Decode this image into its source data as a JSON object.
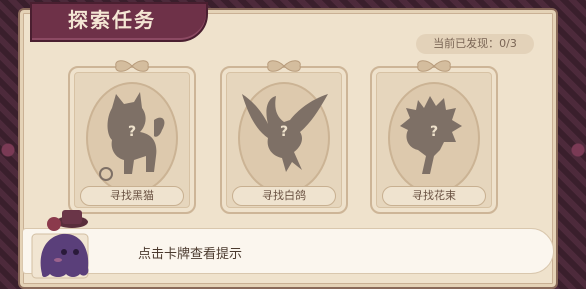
{
  "panel": {
    "title": "探索任务",
    "progress": "当前已发现：0/3"
  },
  "cards": [
    {
      "label": "寻找黑猫",
      "placeholder": "?",
      "icon": "cat-silhouette-icon"
    },
    {
      "label": "寻找白鸽",
      "placeholder": "?",
      "icon": "dove-silhouette-icon"
    },
    {
      "label": "寻找花束",
      "placeholder": "?",
      "icon": "bouquet-silhouette-icon"
    }
  ],
  "hint": {
    "text": "点击卡牌查看提示"
  },
  "colors": {
    "banner": "#6e3148",
    "panel": "#efe2cc",
    "silhouette": "#7e7066",
    "mascot": "#5a3f7a"
  }
}
